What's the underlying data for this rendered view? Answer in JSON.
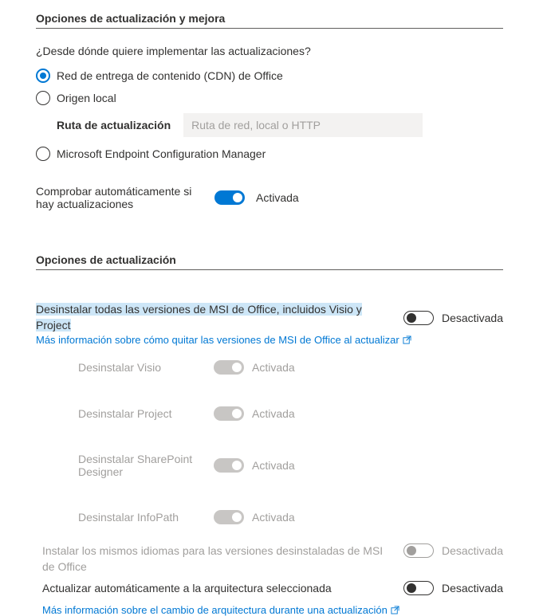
{
  "section1": {
    "title": "Opciones de actualización y mejora",
    "question": "¿Desde dónde quiere implementar las actualizaciones?",
    "radios": {
      "cdn": "Red de entrega de contenido (CDN) de Office",
      "local": "Origen local",
      "localPath": {
        "label": "Ruta de actualización",
        "placeholder": "Ruta de red, local o HTTP"
      },
      "mecm": "Microsoft Endpoint Configuration Manager"
    },
    "autoCheck": {
      "label": "Comprobar automáticamente si hay actualizaciones",
      "status": "Activada"
    }
  },
  "section2": {
    "title": "Opciones de actualización",
    "uninstallMsi": {
      "label": "Desinstalar todas las versiones de MSI de Office, incluidos Visio y Project",
      "status": "Desactivada",
      "link": "Más información sobre cómo quitar las versiones de MSI de Office al actualizar"
    },
    "subs": {
      "visio": "Desinstalar Visio",
      "project": "Desinstalar Project",
      "sharepoint": "Desinstalar SharePoint Designer",
      "infopath": "Desinstalar InfoPath",
      "statusOn": "Activada"
    },
    "installLangs": {
      "label": "Instalar los mismos idiomas para las versiones desinstaladas de MSI de Office",
      "status": "Desactivada"
    },
    "autoArch": {
      "label": "Actualizar automáticamente a la arquitectura seleccionada",
      "status": "Desactivada",
      "link": "Más información sobre el cambio de arquitectura durante una actualización"
    }
  }
}
